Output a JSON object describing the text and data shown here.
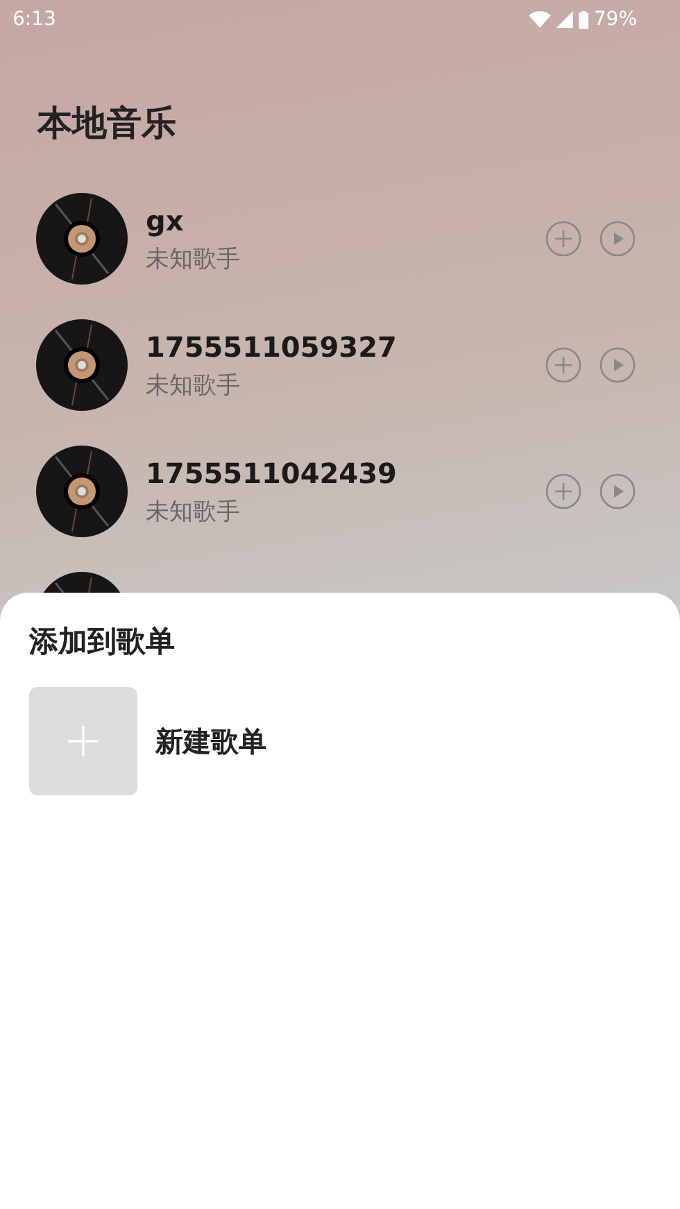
{
  "status_bar": {
    "time": "6:13",
    "battery": "79%"
  },
  "title": "本地音乐",
  "songs": [
    {
      "kind": "full",
      "title": "gx",
      "artist": "未知歌手"
    },
    {
      "kind": "full",
      "title": "1755511059327",
      "artist": "未知歌手"
    },
    {
      "kind": "full",
      "title": "1755511042439",
      "artist": "未知歌手"
    },
    {
      "kind": "covered"
    }
  ],
  "sheet": {
    "title": "添加到歌单",
    "items": [
      {
        "label": "新建歌单"
      }
    ]
  }
}
